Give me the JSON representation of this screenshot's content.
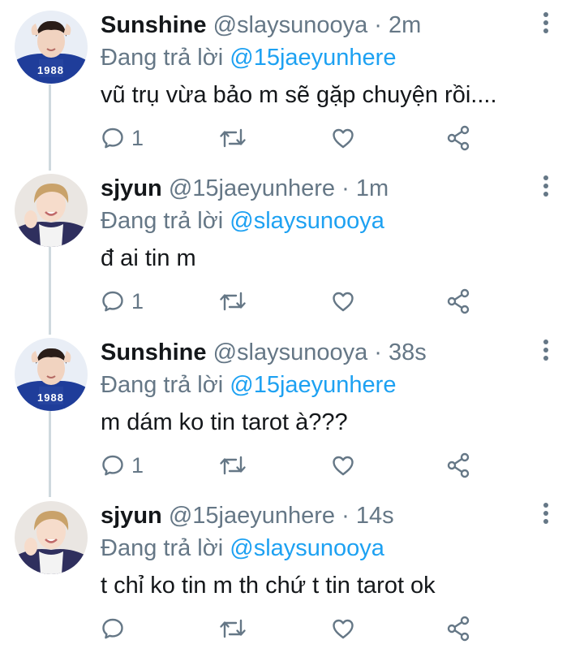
{
  "reply_prefix": "Đang trả lời",
  "colors": {
    "link": "#1da1f2",
    "muted": "#657786",
    "text": "#14171a",
    "thread_line": "#cfd9de"
  },
  "tweets": [
    {
      "display_name": "Sunshine",
      "handle": "@slaysunooya",
      "separator": "·",
      "time": "2m",
      "replying_to": "@15jaeyunhere",
      "text": "vũ trụ vừa bảo m sẽ gặp chuyện rồi....",
      "reply_count": "1",
      "avatar_icon": "avatar-sunshine"
    },
    {
      "display_name": "sjyun",
      "handle": "@15jaeyunhere",
      "separator": "·",
      "time": "1m",
      "replying_to": "@slaysunooya",
      "text": "đ ai tin m",
      "reply_count": "1",
      "avatar_icon": "avatar-sjyun"
    },
    {
      "display_name": "Sunshine",
      "handle": "@slaysunooya",
      "separator": "·",
      "time": "38s",
      "replying_to": "@15jaeyunhere",
      "text": "m dám ko tin tarot à???",
      "reply_count": "1",
      "avatar_icon": "avatar-sunshine"
    },
    {
      "display_name": "sjyun",
      "handle": "@15jaeyunhere",
      "separator": "·",
      "time": "14s",
      "replying_to": "@slaysunooya",
      "text": "t chỉ ko tin m th chứ t tin tarot ok",
      "reply_count": "",
      "avatar_icon": "avatar-sjyun"
    }
  ],
  "avatar_sunshine_jersey": "1988"
}
